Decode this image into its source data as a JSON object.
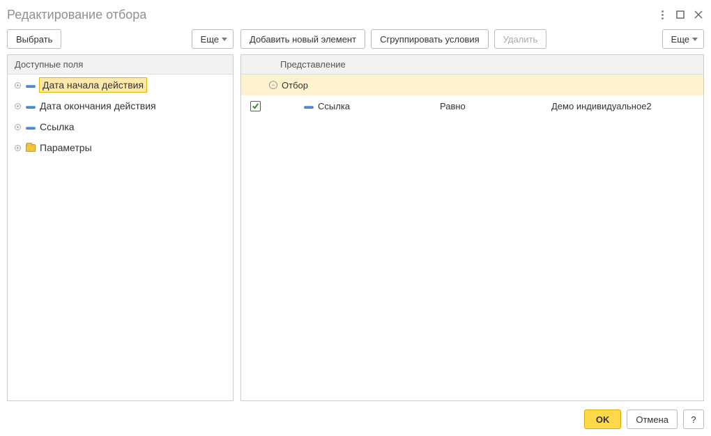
{
  "window": {
    "title": "Редактирование отбора"
  },
  "leftToolbar": {
    "select": "Выбрать",
    "more": "Еще"
  },
  "rightToolbar": {
    "add": "Добавить новый элемент",
    "group": "Сгруппировать условия",
    "delete": "Удалить",
    "more": "Еще"
  },
  "leftPanel": {
    "header": "Доступные поля",
    "items": [
      {
        "label": "Дата начала действия",
        "icon": "bar",
        "selected": true
      },
      {
        "label": "Дата окончания действия",
        "icon": "bar",
        "selected": false
      },
      {
        "label": "Ссылка",
        "icon": "bar",
        "selected": false
      },
      {
        "label": "Параметры",
        "icon": "folder",
        "selected": false
      }
    ]
  },
  "rightPanel": {
    "header": "Представление",
    "root": "Отбор",
    "rows": [
      {
        "checked": true,
        "field": "Ссылка",
        "op": "Равно",
        "value": "Демо индивидуальное2"
      }
    ]
  },
  "footer": {
    "ok": "OK",
    "cancel": "Отмена",
    "help": "?"
  }
}
